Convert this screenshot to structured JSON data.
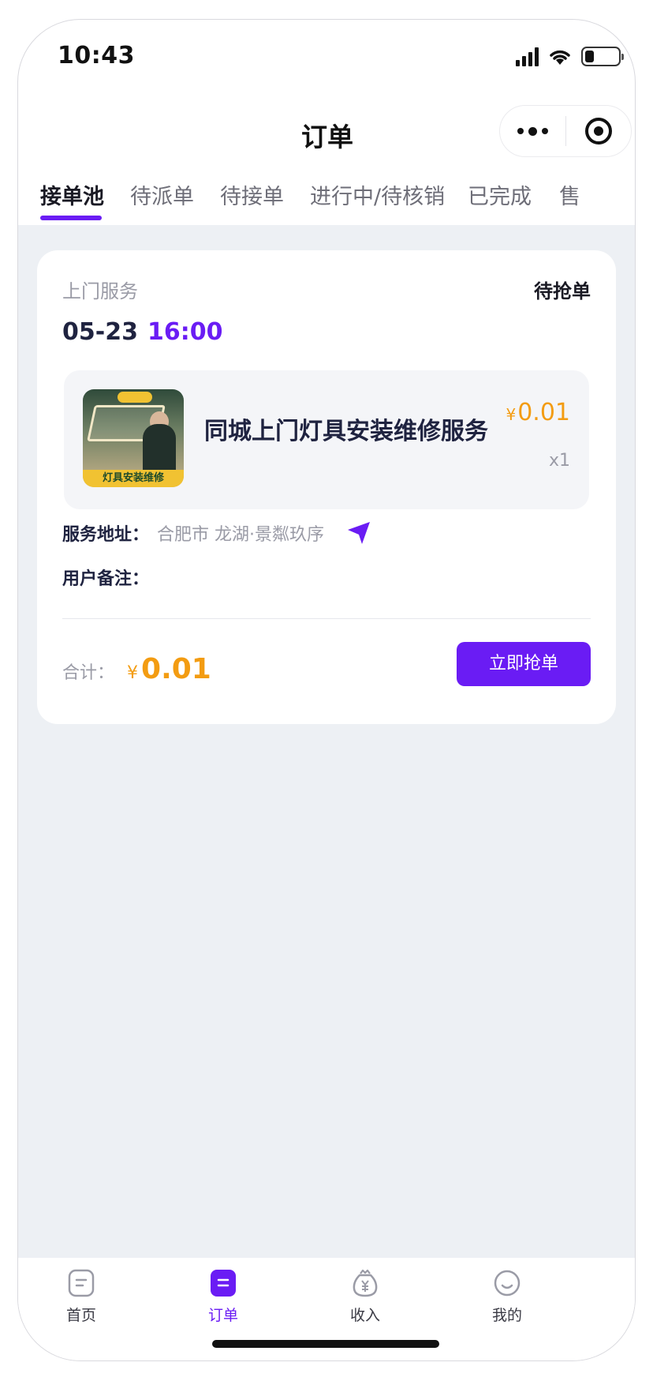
{
  "status_bar": {
    "time": "10:43"
  },
  "nav": {
    "title": "订单"
  },
  "tabs": [
    {
      "label": "接单池",
      "active": true
    },
    {
      "label": "待派单",
      "active": false
    },
    {
      "label": "待接单",
      "active": false
    },
    {
      "label": "进行中/待核销",
      "active": false
    },
    {
      "label": "已完成",
      "active": false
    },
    {
      "label": "售",
      "active": false
    }
  ],
  "order": {
    "service_type": "上门服务",
    "status": "待抢单",
    "date": "05-23",
    "time": "16:00",
    "product": {
      "name": "同城上门灯具安装维修服务",
      "currency": "¥",
      "price": "0.01",
      "quantity": "x1",
      "thumbnail_banner": "灯具安装维修"
    },
    "address_label": "服务地址：",
    "address_value": "合肥市 龙湖·景粼玖序",
    "remark_label": "用户备注：",
    "total_label": "合计：",
    "total_currency": "¥",
    "total_amount": "0.01",
    "action_label": "立即抢单"
  },
  "tabbar": [
    {
      "label": "首页",
      "icon": "home-icon",
      "active": false
    },
    {
      "label": "订单",
      "icon": "order-icon",
      "active": true
    },
    {
      "label": "收入",
      "icon": "income-icon",
      "active": false
    },
    {
      "label": "我的",
      "icon": "profile-icon",
      "active": false
    }
  ],
  "colors": {
    "accent": "#6a1cf4",
    "price": "#f39c12",
    "background": "#edf0f4"
  }
}
